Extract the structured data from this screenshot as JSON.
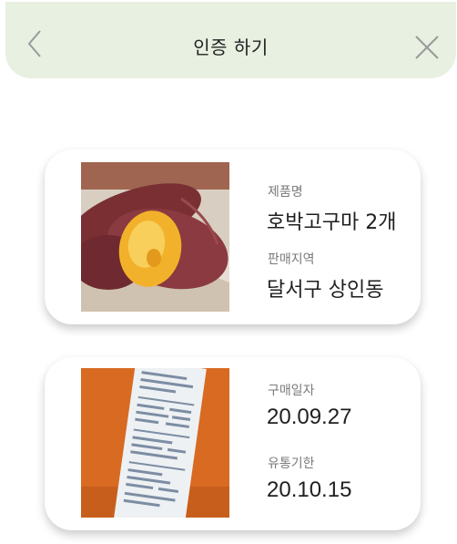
{
  "header": {
    "title": "인증 하기",
    "back_icon": "chevron-left-icon",
    "close_icon": "close-icon",
    "background": "#e8f0e1"
  },
  "product_card": {
    "image": "sweet-potato-photo",
    "name_label": "제품명",
    "name_value": "호박고구마 2개",
    "region_label": "판매지역",
    "region_value": "달서구 상인동"
  },
  "receipt_card": {
    "image": "receipt-photo",
    "purchase_label": "구매일자",
    "purchase_value": "20.09.27",
    "expiry_label": "유통기한",
    "expiry_value": "20.10.15"
  }
}
